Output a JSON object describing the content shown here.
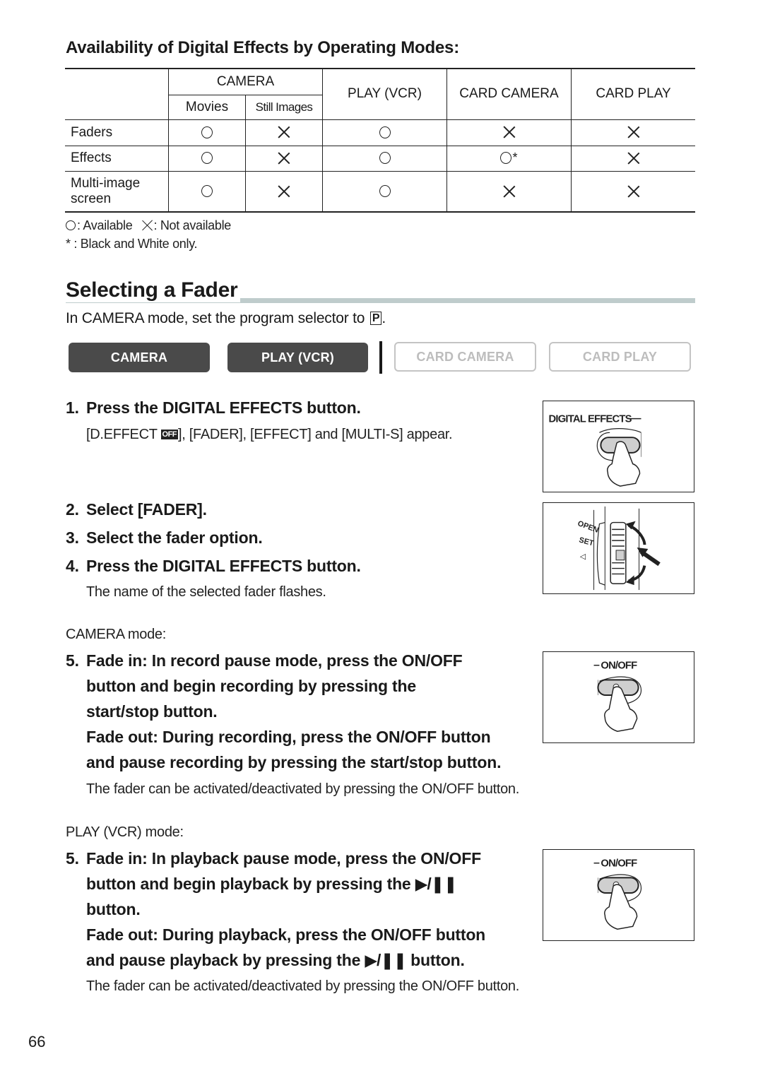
{
  "availability": {
    "heading": "Availability of Digital Effects by Operating Modes:",
    "table": {
      "group_header": "CAMERA",
      "sub_headers": [
        "Movies",
        "Still Images"
      ],
      "columns": [
        "PLAY (VCR)",
        "CARD CAMERA",
        "CARD PLAY"
      ],
      "rows": [
        {
          "label": "Faders",
          "values": [
            "available",
            "not-available",
            "available",
            "not-available",
            "not-available"
          ]
        },
        {
          "label": "Effects",
          "values": [
            "available",
            "not-available",
            "available",
            "available-bw",
            "not-available"
          ]
        },
        {
          "label": "Multi-image screen",
          "label_lines": [
            "Multi-image",
            "screen"
          ],
          "values": [
            "available",
            "not-available",
            "available",
            "not-available",
            "not-available"
          ]
        }
      ],
      "star": "*"
    },
    "legend": {
      "available": ": Available",
      "not_available": ": Not available",
      "footnote": "* : Black and White only."
    }
  },
  "fader": {
    "heading": "Selecting a Fader",
    "intro": "In CAMERA mode, set the program selector to",
    "intro_icon": "P",
    "intro_end": ".",
    "modes": [
      {
        "label": "CAMERA",
        "active": true
      },
      {
        "label": "PLAY (VCR)",
        "active": true
      },
      {
        "label": "CARD CAMERA",
        "active": false
      },
      {
        "label": "CARD PLAY",
        "active": false
      }
    ],
    "steps": {
      "s1_num": "1.",
      "s1": "Press the DIGITAL EFFECTS button.",
      "s1_note_a": "[D.EFFECT ",
      "s1_note_badge": "OFF",
      "s1_note_b": "], [FADER], [EFFECT] and [MULTI-S] appear.",
      "s2_num": "2.",
      "s2": "Select [FADER].",
      "s3_num": "3.",
      "s3": "Select the fader option.",
      "s4_num": "4.",
      "s4": "Press the DIGITAL EFFECTS button.",
      "s4_note": "The name of the selected fader flashes."
    },
    "camera_mode": {
      "label": "CAMERA mode:",
      "num": "5.",
      "line1": "Fade in: In record pause mode, press the ON/OFF",
      "line2": "button and begin recording by pressing the",
      "line3": "start/stop button.",
      "line4": "Fade out: During recording, press the ON/OFF button",
      "line5": "and pause recording by pressing the start/stop button.",
      "note": "The fader can be activated/deactivated by pressing the ON/OFF button."
    },
    "play_mode": {
      "label": "PLAY (VCR) mode:",
      "num": "5.",
      "line1": "Fade in: In playback pause mode, press the ON/OFF",
      "line2a": "button and begin playback by pressing the ",
      "playpause": "▶/❚❚",
      "line3": "button.",
      "line4": "Fade out: During playback, press the ON/OFF button",
      "line5a": "and pause playback by pressing the ",
      "line5b": " button.",
      "note": "The fader can be activated/deactivated by pressing the ON/OFF button."
    },
    "illustrations": {
      "digital_effects_label": "DIGITAL EFFECTS",
      "dial_labels": [
        "OPEN",
        "SET"
      ],
      "on_off_label": "ON/OFF"
    }
  },
  "page_number": "66"
}
